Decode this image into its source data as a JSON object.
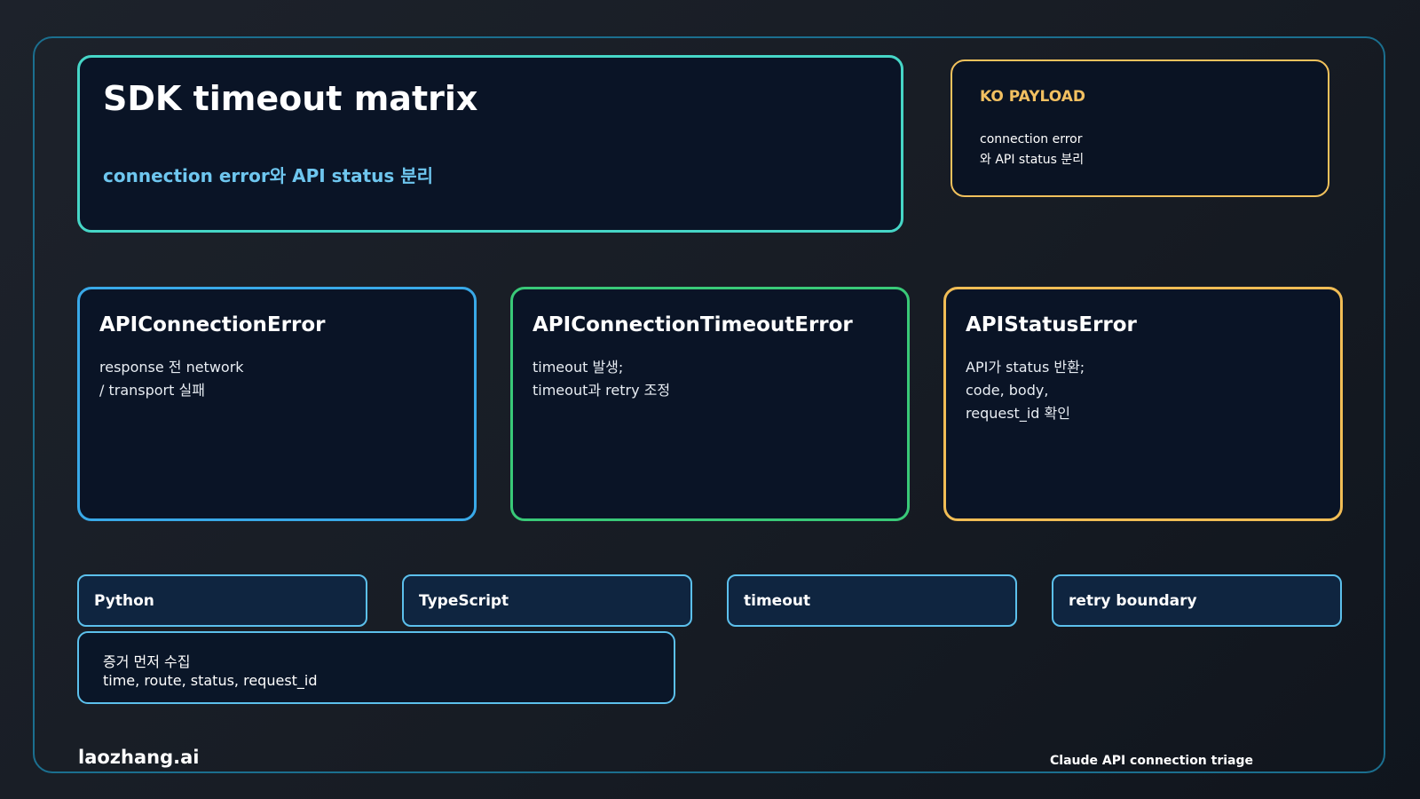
{
  "header": {
    "title": "SDK timeout matrix",
    "subtitle": "connection error와 API status 분리"
  },
  "payload": {
    "label": "KO PAYLOAD",
    "text": "connection error\n와 API status 분리"
  },
  "errors": [
    {
      "title": "APIConnectionError",
      "body": "response 전 network\n/ transport 실패",
      "border_color": "#39a9e8"
    },
    {
      "title": "APIConnectionTimeoutError",
      "body": "timeout 발생;\ntimeout과 retry 조정",
      "border_color": "#39c978"
    },
    {
      "title": "APIStatusError",
      "body": "API가 status 반환;\ncode, body,\nrequest_id 확인",
      "border_color": "#f1bd55"
    }
  ],
  "tags": [
    {
      "label": "Python"
    },
    {
      "label": "TypeScript"
    },
    {
      "label": "timeout"
    },
    {
      "label": "retry boundary"
    }
  ],
  "evidence": {
    "title": "증거 먼저 수집",
    "fields": "time, route, status, request_id"
  },
  "footer": {
    "brand": "laozhang.ai",
    "caption": "Claude API connection triage"
  },
  "colors": {
    "background": "#171c24",
    "frame_border": "#1b6f8f",
    "title_border": "#46d6c7",
    "subtitle_text": "#6ec6ef",
    "payload_accent": "#f2c061",
    "tag_border": "#5cc0ec",
    "card_fill": "#0a1426"
  }
}
